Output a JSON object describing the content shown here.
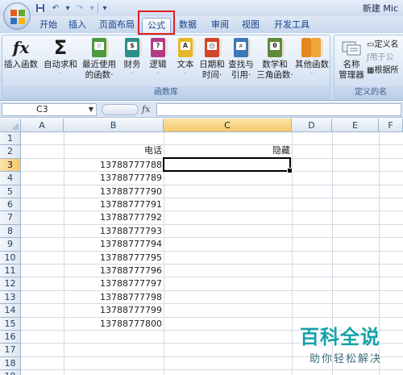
{
  "window": {
    "title": "新建 Mic"
  },
  "tabs": [
    {
      "label": "开始"
    },
    {
      "label": "插入"
    },
    {
      "label": "页面布局"
    },
    {
      "label": "公式",
      "active": true
    },
    {
      "label": "数据"
    },
    {
      "label": "审阅"
    },
    {
      "label": "视图"
    },
    {
      "label": "开发工具"
    }
  ],
  "ribbon": {
    "function_library": {
      "group_label": "函数库",
      "insert_function": "插入函数",
      "autosum": {
        "line1": "自动求和",
        "dd": "·"
      },
      "recent": {
        "line1": "最近使用",
        "line2": "的函数·"
      },
      "financial": {
        "line1": "财务",
        "dd": "·"
      },
      "logical": {
        "line1": "逻辑",
        "dd": "·"
      },
      "text": {
        "line1": "文本",
        "dd": "·"
      },
      "datetime": {
        "line1": "日期和",
        "line2": "时间·"
      },
      "lookup": {
        "line1": "查找与",
        "line2": "引用·"
      },
      "math": {
        "line1": "数学和",
        "line2": "三角函数·"
      },
      "more": {
        "line1": "其他函数",
        "dd": "·"
      }
    },
    "defined_names": {
      "group_label": "定义的名",
      "name_manager": {
        "line1": "名称",
        "line2": "管理器"
      },
      "define_name": "定义名",
      "use_in_formula": "用于公",
      "create_from_selection": "根据所"
    }
  },
  "formula_bar": {
    "name_box": "C3",
    "fx": "fx",
    "value": ""
  },
  "sheet": {
    "columns": [
      "A",
      "B",
      "C",
      "D",
      "E",
      "F"
    ],
    "selected_column": "C",
    "rows": [
      "1",
      "2",
      "3",
      "4",
      "5",
      "6",
      "7",
      "8",
      "9",
      "10",
      "11",
      "12",
      "13",
      "14",
      "15",
      "16",
      "17",
      "18",
      "19"
    ],
    "selected_row": "3",
    "headers": {
      "B2": "电话",
      "C2": "隐藏"
    },
    "phones": [
      "13788777788",
      "13788777789",
      "13788777790",
      "13788777791",
      "13788777792",
      "13788777793",
      "13788777794",
      "13788777795",
      "13788777796",
      "13788777797",
      "13788777798",
      "13788777799",
      "13788777800"
    ]
  },
  "watermark": {
    "line1": "百科全说",
    "line2": "助你轻松解决"
  },
  "colors": {
    "highlight_box": "#e02020",
    "watermark": "#15a1a8"
  }
}
